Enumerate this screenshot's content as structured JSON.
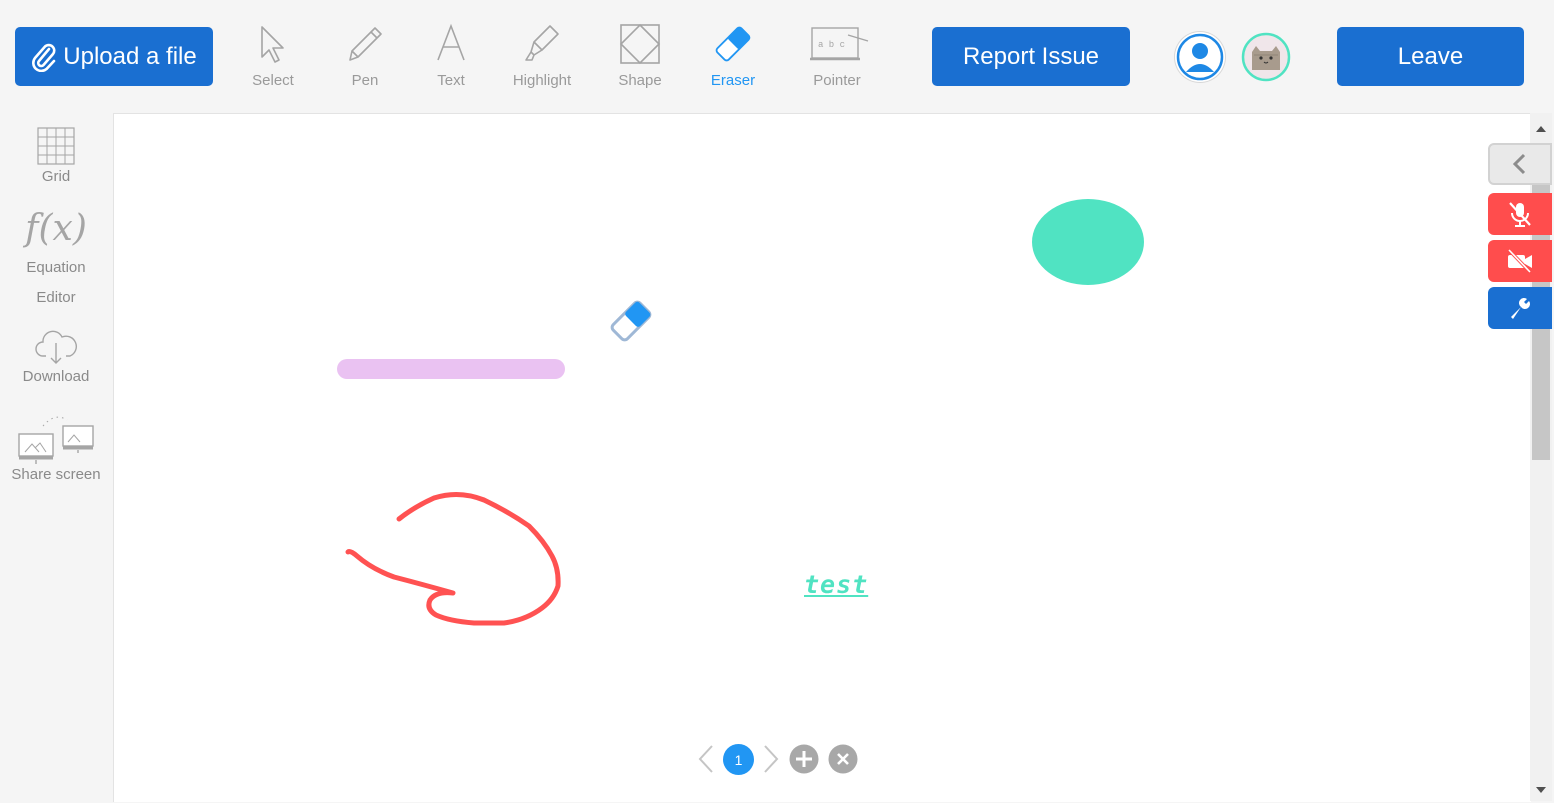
{
  "toolbar": {
    "upload_label": "Upload a file",
    "tools": {
      "select": "Select",
      "pen": "Pen",
      "text": "Text",
      "highlight": "Highlight",
      "shape": "Shape",
      "eraser": "Eraser",
      "pointer": "Pointer"
    },
    "pointer_board_text": "a b c",
    "report_label": "Report Issue",
    "leave_label": "Leave",
    "active_tool": "eraser"
  },
  "sidebar": {
    "grid": "Grid",
    "equation_symbol": "f(x)",
    "equation_line1": "Equation",
    "equation_line2": "Editor",
    "download": "Download",
    "share": "Share screen"
  },
  "board": {
    "text_item": "test",
    "colors": {
      "ellipse": "#50e3c2",
      "highlight_stroke": "#eac2f2",
      "pen_stroke": "#ff5252",
      "text": "#50e3c2"
    }
  },
  "pager": {
    "current_page": "1"
  },
  "colors": {
    "accent": "#1a6fd1",
    "active_tool": "#2196f3",
    "mute_red": "#ff4d4d"
  }
}
